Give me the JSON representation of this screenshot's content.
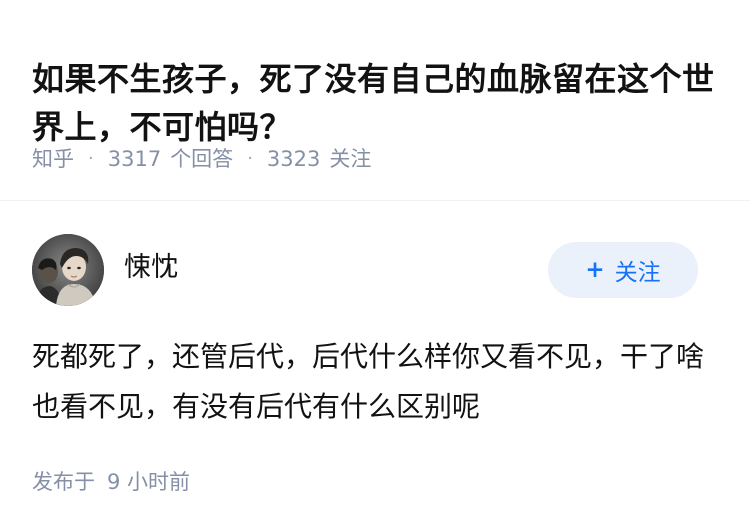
{
  "question": {
    "title": "如果不生孩子，死了没有自己的血脉留在这个世界上，不可怕吗？"
  },
  "meta": {
    "source": "知乎",
    "answer_count": "3317",
    "answer_label": "个回答",
    "follow_count": "3323",
    "follow_label": "关注",
    "separator": "·"
  },
  "author": {
    "name": "悚忱",
    "avatar_icon": "avatar-photo-icon"
  },
  "follow_button": {
    "plus": "+",
    "label": "关注"
  },
  "answer": {
    "text": "死都死了，还管后代，后代什么样你又看不见，干了啥也看不见，有没有后代有什么区别呢"
  },
  "publish": {
    "prefix": "发布于",
    "time": "9 小时前"
  },
  "colors": {
    "meta_gray": "#8590a6",
    "accent_blue": "#1772f6",
    "button_bg": "#eaf1fb"
  }
}
